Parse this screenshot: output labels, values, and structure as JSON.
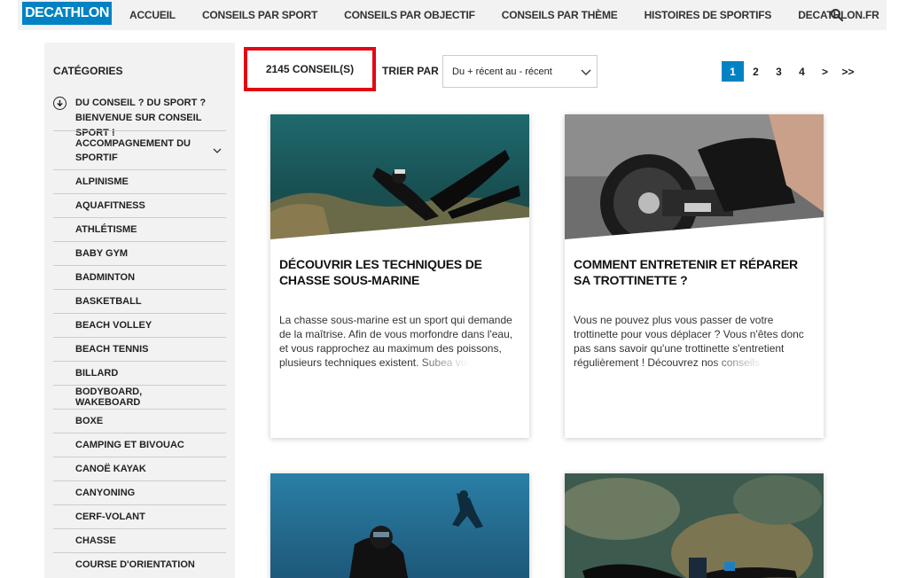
{
  "nav": {
    "logo": "DECATHLON",
    "items": [
      "ACCUEIL",
      "CONSEILS PAR SPORT",
      "CONSEILS PAR OBJECTIF",
      "CONSEILS PAR THÈME",
      "HISTOIRES DE SPORTIFS",
      "DECATHLON.FR"
    ],
    "search_icon": "search-icon"
  },
  "sidebar": {
    "title": "CATÉGORIES",
    "intro": "DU CONSEIL ? DU SPORT ? BIENVENUE SUR CONSEIL SPORT !",
    "items": [
      {
        "label": "ACCOMPAGNEMENT DU SPORTIF",
        "expandable": true
      },
      {
        "label": "ALPINISME"
      },
      {
        "label": "AQUAFITNESS"
      },
      {
        "label": "ATHLÉTISME"
      },
      {
        "label": "BABY GYM"
      },
      {
        "label": "BADMINTON"
      },
      {
        "label": "BASKETBALL"
      },
      {
        "label": "BEACH VOLLEY"
      },
      {
        "label": "BEACH TENNIS"
      },
      {
        "label": "BILLARD"
      },
      {
        "label": "BODYBOARD, WAKEBOARD"
      },
      {
        "label": "BOXE"
      },
      {
        "label": "CAMPING ET BIVOUAC"
      },
      {
        "label": "CANOË KAYAK"
      },
      {
        "label": "CANYONING"
      },
      {
        "label": "CERF-VOLANT"
      },
      {
        "label": "CHASSE"
      },
      {
        "label": "COURSE D'ORIENTATION"
      }
    ]
  },
  "results": {
    "count": "2145 CONSEIL(S)",
    "sort_label": "TRIER PAR",
    "sort_value": "Du + récent au - récent"
  },
  "pagination": [
    "1",
    "2",
    "3",
    "4",
    ">",
    ">>"
  ],
  "pagination_active": "1",
  "cards": [
    {
      "title": "DÉCOUVRIR LES TECHNIQUES DE CHASSE SOUS-MARINE",
      "desc": "La chasse sous-marine est un sport qui demande de la maîtrise. Afin de vous morfondre dans l'eau, et vous rapprochez au maximum des poissons, plusieurs techniques existent. Subea vou"
    },
    {
      "title": "COMMENT ENTRETENIR ET RÉPARER SA TROTTINETTE ?",
      "desc": "Vous ne pouvez plus vous passer de votre trottinette pour vous déplacer ? Vous n'êtes donc pas sans savoir qu'une trottinette s'entretient régulièrement ! Découvrez nos conseils et"
    },
    {
      "title": "",
      "desc": ""
    },
    {
      "title": "",
      "desc": ""
    }
  ],
  "colors": {
    "brand_blue": "#0082c3",
    "highlight_red": "#e30613",
    "nav_bg": "#f2f2f2"
  }
}
